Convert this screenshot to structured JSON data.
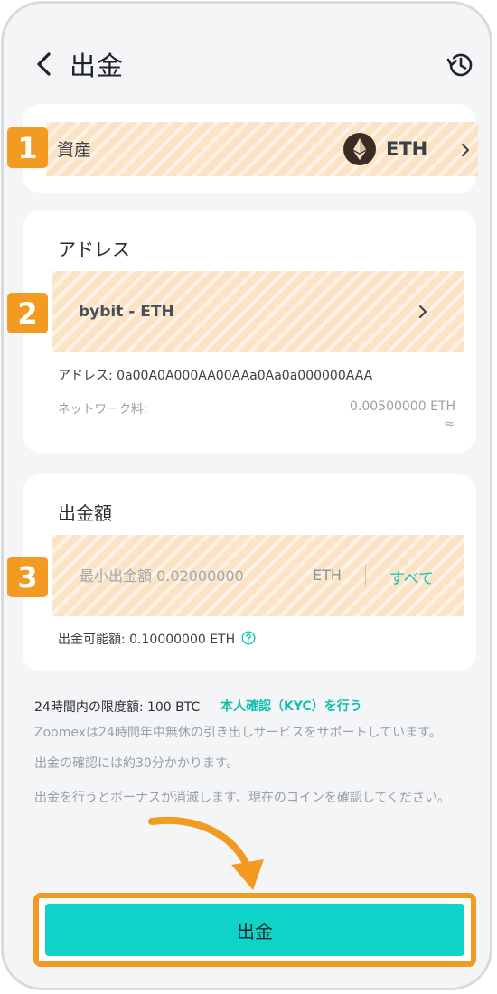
{
  "header": {
    "title": "出金",
    "back_icon": "chevron-left-icon",
    "history_icon": "history-icon"
  },
  "asset": {
    "badge": "1",
    "label": "資産",
    "value": "ETH",
    "coin_icon": "ethereum-icon"
  },
  "address": {
    "badge": "2",
    "title": "アドレス",
    "selected": "bybit - ETH",
    "address_text": "アドレス: 0a00A0A000AA00AAa0Aa0a000000AAA",
    "fee_label": "ネットワーク料:",
    "fee_value": "0.00500000 ETH",
    "fee_approx": "≈"
  },
  "amount": {
    "badge": "3",
    "title": "出金額",
    "placeholder": "最小出金額 0.02000000",
    "unit": "ETH",
    "all_label": "すべて",
    "available": "出金可能額: 0.10000000 ETH"
  },
  "info": {
    "limit_label": "24時間内の限度額: 100 BTC",
    "kyc_link": "本人確認（KYC）を行う",
    "line1": "Zoomexは24時間年中無休の引き出しサービスをサポートしています。",
    "line2": "出金の確認には約30分かかります。",
    "line3": "出金を行うとボーナスが消滅します、現在のコインを確認してください。"
  },
  "submit": {
    "label": "出金"
  },
  "colors": {
    "accent_teal": "#0fd3c6",
    "link_teal": "#12bfae",
    "highlight_orange": "#f29a21",
    "hatch_fill": "#fbe3c6",
    "background": "#f4f5f7"
  }
}
